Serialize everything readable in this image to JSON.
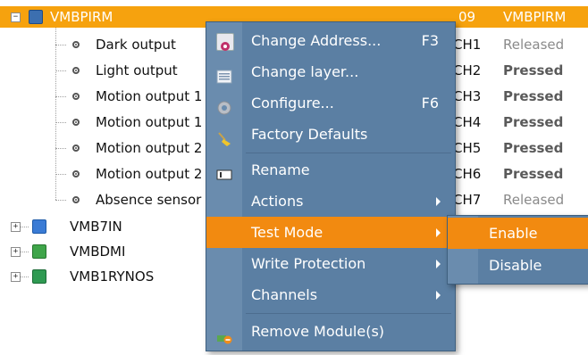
{
  "tree": {
    "selected_module": {
      "name": "VMBPIRM",
      "address": "09",
      "type": "VMBPIRM"
    },
    "channels": [
      {
        "name": "Dark output",
        "channel": "CH1",
        "status": "Released"
      },
      {
        "name": "Light output",
        "channel": "CH2",
        "status": "Pressed"
      },
      {
        "name": "Motion output 1",
        "channel": "CH3",
        "status": "Pressed"
      },
      {
        "name": "Motion output 1",
        "channel": "CH4",
        "status": "Pressed"
      },
      {
        "name": "Motion output 2",
        "channel": "CH5",
        "status": "Pressed"
      },
      {
        "name": "Motion output 2",
        "channel": "CH6",
        "status": "Pressed"
      },
      {
        "name": "Absence sensor",
        "channel": "CH7",
        "status": "Released"
      }
    ],
    "other_modules": [
      {
        "name": "VMB7IN"
      },
      {
        "name": "VMBDMI"
      },
      {
        "name": "VMB1RYNOS"
      }
    ]
  },
  "context_menu": {
    "items": [
      {
        "label": "Change Address...",
        "shortcut": "F3"
      },
      {
        "label": "Change layer..."
      },
      {
        "label": "Configure...",
        "shortcut": "F6"
      },
      {
        "label": "Factory Defaults"
      },
      {
        "label": "Rename"
      },
      {
        "label": "Actions"
      },
      {
        "label": "Test Mode"
      },
      {
        "label": "Write Protection"
      },
      {
        "label": "Channels"
      },
      {
        "label": "Remove Module(s)"
      }
    ]
  },
  "submenu": {
    "items": [
      {
        "label": "Enable"
      },
      {
        "label": "Disable"
      }
    ]
  },
  "colors": {
    "selection": "#f6a20e",
    "menu_bg": "#5b7fa3",
    "menu_highlight": "#f28a10"
  }
}
